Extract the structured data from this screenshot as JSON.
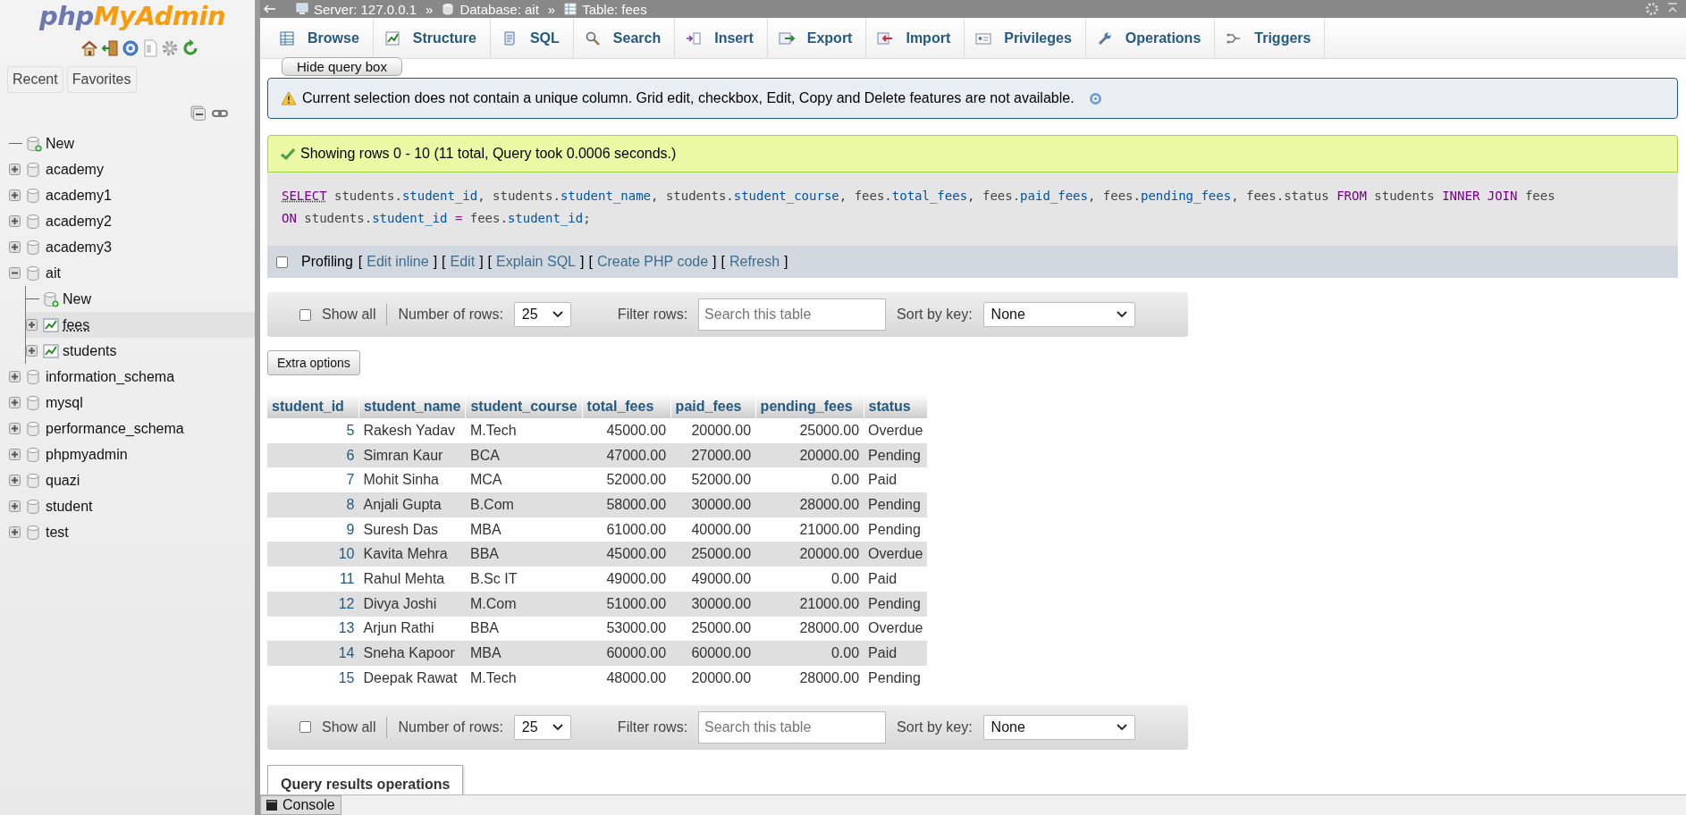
{
  "sidebar": {
    "logo": {
      "first": "php",
      "second": "MyAdmin"
    },
    "tabs": [
      {
        "label": "Recent",
        "selected": false
      },
      {
        "label": "Favorites",
        "selected": false
      }
    ],
    "tree": [
      {
        "label": "New",
        "kind": "new",
        "selected": false
      },
      {
        "label": "academy",
        "kind": "database",
        "expanded": false,
        "selected": false
      },
      {
        "label": "academy1",
        "kind": "database",
        "expanded": false,
        "selected": false
      },
      {
        "label": "academy2",
        "kind": "database",
        "expanded": false,
        "selected": false
      },
      {
        "label": "academy3",
        "kind": "database",
        "expanded": false,
        "selected": false
      },
      {
        "label": "ait",
        "kind": "database",
        "expanded": true,
        "selected": false,
        "children": [
          {
            "label": "New",
            "kind": "new",
            "selected": false
          },
          {
            "label": "fees",
            "kind": "table",
            "expanded": false,
            "selected": true
          },
          {
            "label": "students",
            "kind": "table",
            "expanded": false,
            "selected": false
          }
        ]
      },
      {
        "label": "information_schema",
        "kind": "database",
        "expanded": false,
        "selected": false
      },
      {
        "label": "mysql",
        "kind": "database",
        "expanded": false,
        "selected": false
      },
      {
        "label": "performance_schema",
        "kind": "database",
        "expanded": false,
        "selected": false
      },
      {
        "label": "phpmyadmin",
        "kind": "database",
        "expanded": false,
        "selected": false
      },
      {
        "label": "quazi",
        "kind": "database",
        "expanded": false,
        "selected": false
      },
      {
        "label": "student",
        "kind": "database",
        "expanded": false,
        "selected": false
      },
      {
        "label": "test",
        "kind": "database",
        "expanded": false,
        "selected": false
      }
    ]
  },
  "breadcrumb": {
    "separator": "»",
    "items": [
      "Server: 127.0.0.1",
      "Database: ait",
      "Table: fees"
    ]
  },
  "tabs": [
    {
      "label": "Browse",
      "selected": false
    },
    {
      "label": "Structure",
      "selected": false
    },
    {
      "label": "SQL",
      "selected": false
    },
    {
      "label": "Search",
      "selected": false
    },
    {
      "label": "Insert",
      "selected": false
    },
    {
      "label": "Export",
      "selected": false
    },
    {
      "label": "Import",
      "selected": false
    },
    {
      "label": "Privileges",
      "selected": false
    },
    {
      "label": "Operations",
      "selected": false
    },
    {
      "label": "Triggers",
      "selected": false
    }
  ],
  "hide_query_button": "Hide query box",
  "notice": "Current selection does not contain a unique column. Grid edit, checkbox, Edit, Copy and Delete features are not available.",
  "success": "Showing rows 0 - 10 (11 total, Query took 0.0006 seconds.)",
  "sql": {
    "lines": [
      [
        {
          "t": "SELECT",
          "kind": "select"
        },
        {
          "t": " students.",
          "kind": "plain"
        },
        {
          "t": "student_id",
          "kind": "column"
        },
        {
          "t": ", students.",
          "kind": "plain"
        },
        {
          "t": "student_name",
          "kind": "column"
        },
        {
          "t": ", students.",
          "kind": "plain"
        },
        {
          "t": "student_course",
          "kind": "column"
        },
        {
          "t": ", fees.",
          "kind": "plain"
        },
        {
          "t": "total_fees",
          "kind": "column"
        },
        {
          "t": ", fees.",
          "kind": "plain"
        },
        {
          "t": "paid_fees",
          "kind": "column"
        },
        {
          "t": ", fees.",
          "kind": "plain"
        },
        {
          "t": "pending_fees",
          "kind": "column"
        },
        {
          "t": ", fees.status ",
          "kind": "plain"
        },
        {
          "t": "FROM",
          "kind": "keyword"
        },
        {
          "t": " students ",
          "kind": "plain"
        },
        {
          "t": "INNER JOIN",
          "kind": "keyword"
        },
        {
          "t": " fees",
          "kind": "plain"
        }
      ],
      [
        {
          "t": "ON",
          "kind": "keyword"
        },
        {
          "t": " students.",
          "kind": "plain"
        },
        {
          "t": "student_id",
          "kind": "column"
        },
        {
          "t": " = ",
          "kind": "operator"
        },
        {
          "t": "fees.",
          "kind": "plain"
        },
        {
          "t": "student_id",
          "kind": "column"
        },
        {
          "t": ";",
          "kind": "plain"
        }
      ]
    ]
  },
  "profiling": {
    "label": "Profiling",
    "checked": false,
    "bracket_open": "[",
    "bracket_close": "]",
    "links": [
      "Edit inline",
      "Edit",
      "Explain SQL",
      "Create PHP code",
      "Refresh"
    ]
  },
  "nav_bars": [
    {
      "show_all": "Show all",
      "show_all_checked": false,
      "rows_label": "Number of rows:",
      "rows_value": "25",
      "filter_label": "Filter rows:",
      "filter_placeholder": "Search this table",
      "sort_label": "Sort by key:",
      "sort_value": "None"
    },
    {
      "show_all": "Show all",
      "show_all_checked": false,
      "rows_label": "Number of rows:",
      "rows_value": "25",
      "filter_label": "Filter rows:",
      "filter_placeholder": "Search this table",
      "sort_label": "Sort by key:",
      "sort_value": "None"
    }
  ],
  "extra_options": "Extra options",
  "table": {
    "columns": [
      {
        "label": "student_id",
        "kind": "id"
      },
      {
        "label": "student_name",
        "kind": "text"
      },
      {
        "label": "student_course",
        "kind": "text"
      },
      {
        "label": "total_fees",
        "kind": "number"
      },
      {
        "label": "paid_fees",
        "kind": "number"
      },
      {
        "label": "pending_fees",
        "kind": "number"
      },
      {
        "label": "status",
        "kind": "text"
      }
    ],
    "rows": [
      [
        "5",
        "Rakesh Yadav",
        "M.Tech",
        "45000.00",
        "20000.00",
        "25000.00",
        "Overdue"
      ],
      [
        "6",
        "Simran Kaur",
        "BCA",
        "47000.00",
        "27000.00",
        "20000.00",
        "Pending"
      ],
      [
        "7",
        "Mohit Sinha",
        "MCA",
        "52000.00",
        "52000.00",
        "0.00",
        "Paid"
      ],
      [
        "8",
        "Anjali Gupta",
        "B.Com",
        "58000.00",
        "30000.00",
        "28000.00",
        "Pending"
      ],
      [
        "9",
        "Suresh Das",
        "MBA",
        "61000.00",
        "40000.00",
        "21000.00",
        "Pending"
      ],
      [
        "10",
        "Kavita Mehra",
        "BBA",
        "45000.00",
        "25000.00",
        "20000.00",
        "Overdue"
      ],
      [
        "11",
        "Rahul Mehta",
        "B.Sc IT",
        "49000.00",
        "49000.00",
        "0.00",
        "Paid"
      ],
      [
        "12",
        "Divya Joshi",
        "M.Com",
        "51000.00",
        "30000.00",
        "21000.00",
        "Pending"
      ],
      [
        "13",
        "Arjun Rathi",
        "BBA",
        "53000.00",
        "25000.00",
        "28000.00",
        "Overdue"
      ],
      [
        "14",
        "Sneha Kapoor",
        "MBA",
        "60000.00",
        "60000.00",
        "0.00",
        "Paid"
      ],
      [
        "15",
        "Deepak Rawat",
        "M.Tech",
        "48000.00",
        "20000.00",
        "28000.00",
        "Pending"
      ]
    ]
  },
  "query_ops": "Query results operations",
  "console": "Console"
}
